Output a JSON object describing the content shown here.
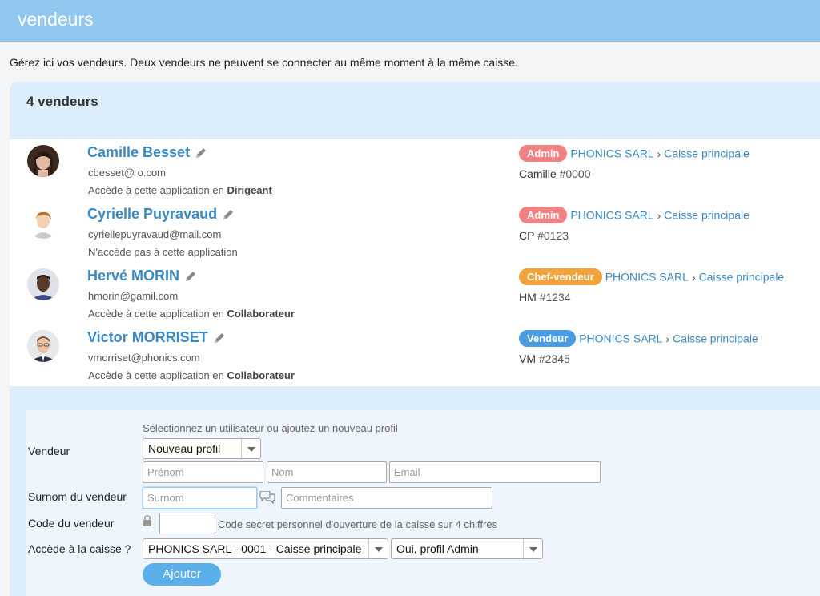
{
  "header": {
    "title": "vendeurs"
  },
  "intro": "Gérez ici vos vendeurs. Deux vendeurs ne peuvent se connecter au même moment à la même caisse.",
  "panel": {
    "count_label": "4 vendeurs"
  },
  "vendors": [
    {
      "name": "Camille Besset",
      "email": "cbesset@        o.com",
      "access_prefix": "Accède à cette application en",
      "access_role": "Dirigeant",
      "badge": "Admin",
      "badge_color": "#ef8383",
      "company": "PHONICS SARL",
      "register": "Caisse principale",
      "nickname": "Camille",
      "code": "#0000"
    },
    {
      "name": "Cyrielle Puyravaud",
      "email": "cyriellepuyravaud@mail.com",
      "access_prefix": "N'accède pas à cette application",
      "access_role": "",
      "badge": "Admin",
      "badge_color": "#ef8383",
      "company": "PHONICS SARL",
      "register": "Caisse principale",
      "nickname": "CP",
      "code": "#0123"
    },
    {
      "name": "Hervé MORIN",
      "email": "hmorin@gamil.com",
      "access_prefix": "Accède à cette application en",
      "access_role": "Collaborateur",
      "badge": "Chef-vendeur",
      "badge_color": "#f2a33a",
      "company": "PHONICS SARL",
      "register": "Caisse principale",
      "nickname": "HM",
      "code": "#1234"
    },
    {
      "name": "Victor MORRISET",
      "email": "vmorriset@phonics.com",
      "access_prefix": "Accède à cette application en",
      "access_role": "Collaborateur",
      "badge": "Vendeur",
      "badge_color": "#4a9be0",
      "company": "PHONICS SARL",
      "register": "Caisse principale",
      "nickname": "VM",
      "code": "#2345"
    }
  ],
  "form": {
    "vendor_label": "Vendeur",
    "vendor_hint": "Sélectionnez un utilisateur ou ajoutez un nouveau profil",
    "profile_select": "Nouveau profil",
    "firstname_placeholder": "Prénom",
    "lastname_placeholder": "Nom",
    "email_placeholder": "Email",
    "nickname_label": "Surnom du vendeur",
    "nickname_placeholder": "Surnom",
    "comments_placeholder": "Commentaires",
    "code_label": "Code du vendeur",
    "code_hint": "Code secret personnel d'ouverture de la caisse sur 4 chiffres",
    "register_label": "Accède à la caisse ?",
    "register_select": "PHONICS SARL - 0001 - Caisse principale",
    "admin_select": "Oui, profil Admin",
    "add_button": "Ajouter"
  },
  "icons": {
    "edit": "pencil-icon",
    "comment": "speech-bubbles-icon",
    "lock": "lock-icon",
    "dropdown": "caret-down-icon"
  },
  "colors": {
    "header_bg": "#91c6ee",
    "link": "#3c8ac4",
    "panel_bg": "#dcedfc",
    "button": "#5aaee9"
  }
}
